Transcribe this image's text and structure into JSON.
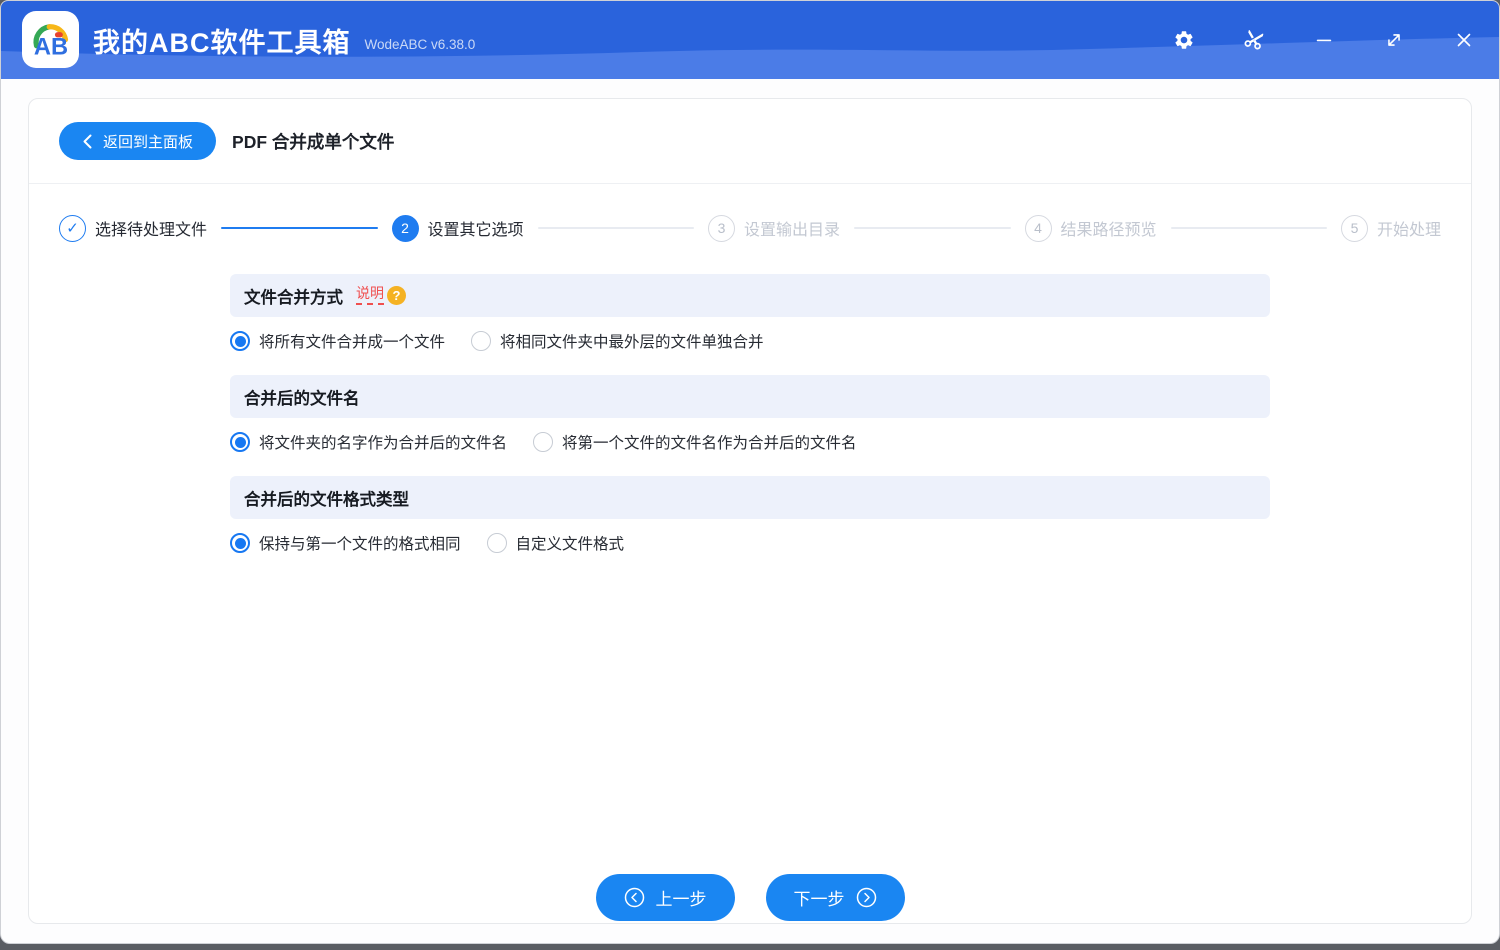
{
  "titlebar": {
    "app_title": "我的ABC软件工具箱",
    "version": "WodeABC v6.38.0",
    "logo_text": "AB"
  },
  "header": {
    "back_label": "返回到主面板",
    "page_title": "PDF 合并成单个文件"
  },
  "stepper": [
    {
      "num": "1",
      "label": "选择待处理文件",
      "state": "done"
    },
    {
      "num": "2",
      "label": "设置其它选项",
      "state": "active"
    },
    {
      "num": "3",
      "label": "设置输出目录",
      "state": "pending"
    },
    {
      "num": "4",
      "label": "结果路径预览",
      "state": "pending"
    },
    {
      "num": "5",
      "label": "开始处理",
      "state": "pending"
    }
  ],
  "sections": [
    {
      "title": "文件合并方式",
      "help_link": "说明",
      "options": [
        {
          "label": "将所有文件合并成一个文件",
          "selected": true
        },
        {
          "label": "将相同文件夹中最外层的文件单独合并",
          "selected": false
        }
      ]
    },
    {
      "title": "合并后的文件名",
      "options": [
        {
          "label": "将文件夹的名字作为合并后的文件名",
          "selected": true
        },
        {
          "label": "将第一个文件的文件名作为合并后的文件名",
          "selected": false
        }
      ]
    },
    {
      "title": "合并后的文件格式类型",
      "options": [
        {
          "label": "保持与第一个文件的格式相同",
          "selected": true
        },
        {
          "label": "自定义文件格式",
          "selected": false
        }
      ]
    }
  ],
  "footer": {
    "prev_label": "上一步",
    "next_label": "下一步"
  },
  "glyphs": {
    "check": "✓",
    "help": "?"
  },
  "icons": {
    "titlebar": [
      "gear-icon",
      "scissors-icon",
      "minimize-icon",
      "resize-diagonal-icon",
      "close-icon"
    ],
    "back": "chevron-left-icon",
    "prev": "circle-chevron-left-icon",
    "next": "circle-chevron-right-icon",
    "step_done": "check-icon",
    "help": "question-circle-icon"
  },
  "colors": {
    "titlebar_blue": "#2a63dc",
    "titlebar_wave_blue": "#4b7ce7",
    "accent_blue": "#1a86f2",
    "step_blue": "#1f7cf0",
    "radio_blue": "#1778f2",
    "section_band_bg": "#edf1fb",
    "help_red": "#f04f4f",
    "help_icon_orange": "#f5b223"
  }
}
